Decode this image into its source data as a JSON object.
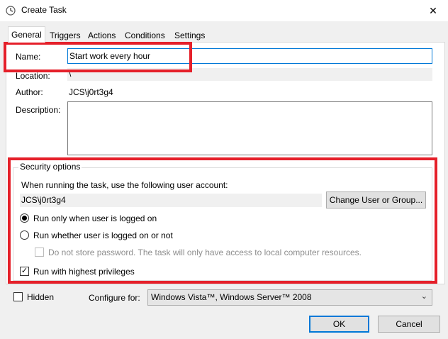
{
  "window": {
    "title": "Create Task",
    "close_glyph": "✕",
    "icon": "clock-icon"
  },
  "tabs": [
    {
      "label": "General",
      "active": true
    },
    {
      "label": "Triggers",
      "active": false
    },
    {
      "label": "Actions",
      "active": false
    },
    {
      "label": "Conditions",
      "active": false
    },
    {
      "label": "Settings",
      "active": false
    }
  ],
  "general": {
    "name_label": "Name:",
    "name_value": "Start work every hour",
    "location_label": "Location:",
    "location_value": "\\",
    "author_label": "Author:",
    "author_value": "JCS\\j0rt3g4",
    "description_label": "Description:",
    "description_value": ""
  },
  "security": {
    "group_title": "Security options",
    "account_prompt": "When running the task, use the following user account:",
    "account_value": "JCS\\j0rt3g4",
    "change_user_button": "Change User or Group...",
    "radio_logged_on": "Run only when user is logged on",
    "radio_logged_on_checked": true,
    "radio_whether": "Run whether user is logged on or not",
    "radio_whether_checked": false,
    "no_store_password": "Do not store password.  The task will only have access to local computer resources.",
    "highest_privileges": "Run with highest privileges",
    "highest_privileges_checked": true,
    "checkmark": "✓"
  },
  "footer": {
    "hidden_label": "Hidden",
    "configure_label": "Configure for:",
    "configure_value": "Windows Vista™, Windows Server™ 2008",
    "chevron": "⌄",
    "ok_button": "OK",
    "cancel_button": "Cancel"
  },
  "colors": {
    "accent": "#0078d7",
    "highlight_red": "#e5202a"
  }
}
